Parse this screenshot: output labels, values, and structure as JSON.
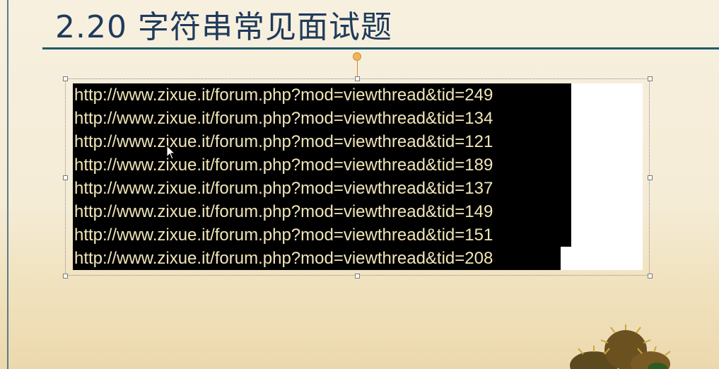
{
  "slide": {
    "title": "2.20 字符串常见面试题"
  },
  "textbox": {
    "lines": [
      "http://www.zixue.it/forum.php?mod=viewthread&tid=249",
      "http://www.zixue.it/forum.php?mod=viewthread&tid=134",
      "http://www.zixue.it/forum.php?mod=viewthread&tid=121",
      "http://www.zixue.it/forum.php?mod=viewthread&tid=189",
      "http://www.zixue.it/forum.php?mod=viewthread&tid=137",
      "http://www.zixue.it/forum.php?mod=viewthread&tid=149",
      "http://www.zixue.it/forum.php?mod=viewthread&tid=151",
      "http://www.zixue.it/forum.php?mod=viewthread&tid=208"
    ]
  },
  "colors": {
    "title": "#1f3a5c",
    "underline": "#1f5a6a",
    "code_bg": "#000000",
    "code_text": "#f0e6b8",
    "background": "#f5ecd6"
  },
  "icons": {
    "cursor": "mouse-pointer-icon",
    "rotate": "rotate-handle-icon",
    "decoration": "chestnut-decoration-icon"
  }
}
